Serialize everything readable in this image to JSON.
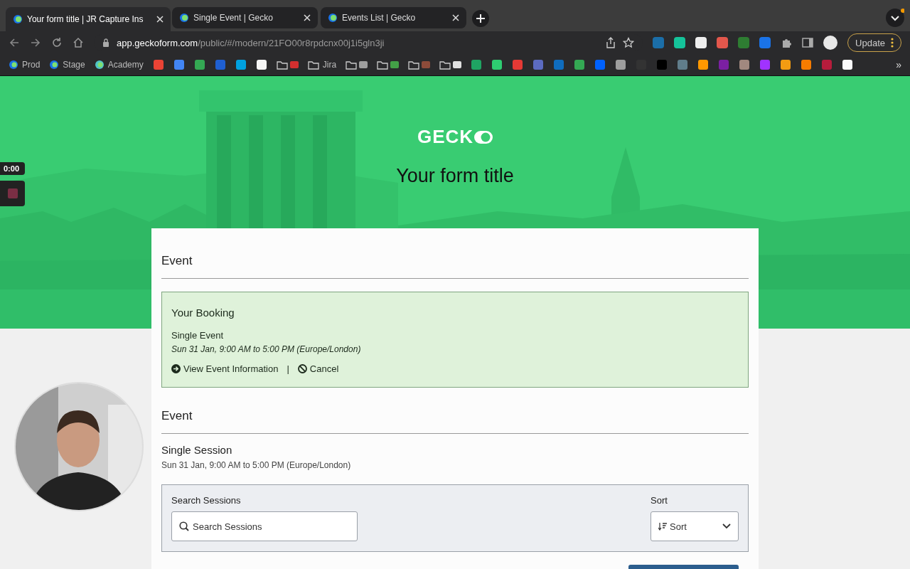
{
  "browser": {
    "tabs": [
      {
        "title": "Your form title | JR Capture Ins",
        "selected": true
      },
      {
        "title": "Single Event | Gecko",
        "selected": false
      },
      {
        "title": "Events List | Gecko",
        "selected": false
      }
    ],
    "address": {
      "host": "app.geckoform.com",
      "path": "/public/#/modern/21FO00r8rpdcnx00j1i5gln3ji"
    },
    "extensions": [
      {
        "color": "#1b6ea8"
      },
      {
        "color": "#15c39a"
      },
      {
        "color": "#eeeeee"
      },
      {
        "color": "#e2574c"
      },
      {
        "color": "#2e7d32"
      },
      {
        "color": "#1a73e8"
      }
    ],
    "update_button": "Update",
    "bookmarks": [
      {
        "kind": "site",
        "label": "Prod",
        "color": "#1a73e8"
      },
      {
        "kind": "site",
        "label": "Stage",
        "color": "#1a73e8"
      },
      {
        "kind": "site",
        "label": "Academy",
        "color": "#4fc3c7"
      },
      {
        "kind": "icon",
        "color": "#ea4335"
      },
      {
        "kind": "icon",
        "color": "#4285f4"
      },
      {
        "kind": "icon",
        "color": "#34a853"
      },
      {
        "kind": "icon",
        "color": "#1f5fd1"
      },
      {
        "kind": "icon",
        "color": "#00a1e0"
      },
      {
        "kind": "icon",
        "color": "#f5f5f5"
      },
      {
        "kind": "folder",
        "color": "#d32f2f"
      },
      {
        "kind": "folder",
        "label": "Jira"
      },
      {
        "kind": "folder",
        "color": "#9e9e9e"
      },
      {
        "kind": "folder",
        "color": "#43a047"
      },
      {
        "kind": "folder",
        "color": "#8d4b3a"
      },
      {
        "kind": "folder",
        "color": "#e0e0e0"
      },
      {
        "kind": "icon",
        "color": "#1fa463"
      },
      {
        "kind": "icon",
        "color": "#2ecc71"
      },
      {
        "kind": "icon",
        "color": "#e53935"
      },
      {
        "kind": "icon",
        "color": "#5c6bc0"
      },
      {
        "kind": "icon",
        "color": "#0f6cbd"
      },
      {
        "kind": "icon",
        "color": "#34a853"
      },
      {
        "kind": "icon",
        "color": "#0061fe"
      },
      {
        "kind": "icon",
        "color": "#9e9e9e"
      },
      {
        "kind": "icon",
        "color": "#333333"
      },
      {
        "kind": "icon",
        "color": "#000000"
      },
      {
        "kind": "icon",
        "color": "#607d8b"
      },
      {
        "kind": "icon",
        "color": "#ff9800"
      },
      {
        "kind": "icon",
        "color": "#7b1fa2"
      },
      {
        "kind": "icon",
        "color": "#a1887f"
      },
      {
        "kind": "icon",
        "color": "#a033ff"
      },
      {
        "kind": "icon",
        "color": "#f39c12"
      },
      {
        "kind": "icon",
        "color": "#f57c00"
      },
      {
        "kind": "icon",
        "color": "#b71c3c"
      },
      {
        "kind": "icon",
        "color": "#fafafa"
      }
    ],
    "more": "»"
  },
  "recorder": {
    "time": "0:00"
  },
  "form": {
    "logo_text": "GECK",
    "title": "Your form title",
    "heading": "Event",
    "booking": {
      "heading": "Your Booking",
      "event": "Single Event",
      "when": "Sun 31 Jan, 9:00 AM to 5:00 PM (Europe/London)",
      "links": [
        {
          "kind": "view",
          "label": "View Event Information"
        },
        {
          "kind": "cancel",
          "label": "Cancel"
        }
      ],
      "separator": "|"
    },
    "event_heading": "Event",
    "session": {
      "title": "Single Session",
      "when": "Sun 31 Jan, 9:00 AM to 5:00 PM (Europe/London)"
    },
    "search": {
      "label": "Search Sessions",
      "placeholder": "Search Sessions"
    },
    "sort": {
      "label": "Sort",
      "value": "Sort"
    }
  }
}
